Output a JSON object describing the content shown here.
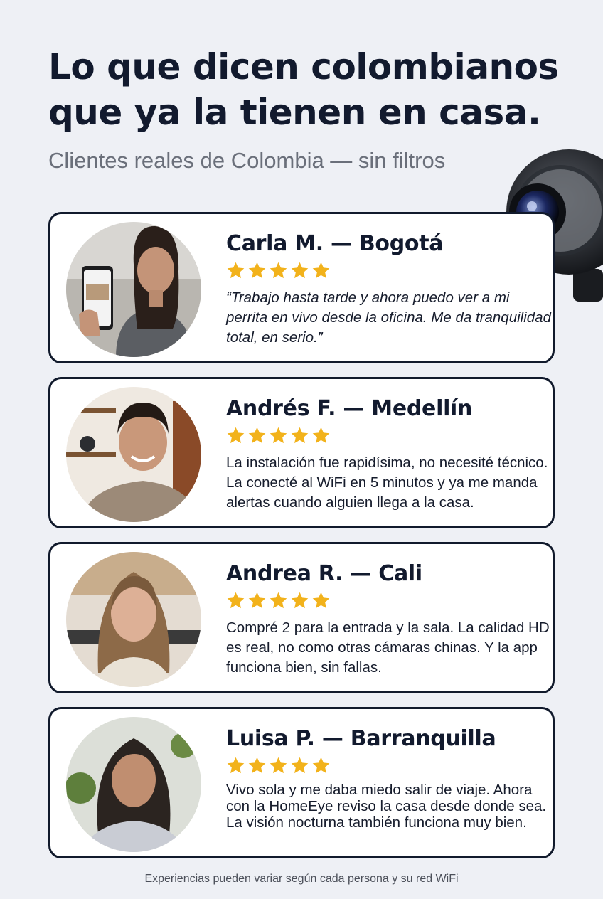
{
  "header": {
    "title": "Lo que dicen colombianos que ya la tienen en casa.",
    "subtitle": "Clientes reales de Colombia — sin filtros"
  },
  "product": {
    "icon": "security-camera-icon"
  },
  "star_color": "#f2b21b",
  "reviews": [
    {
      "name": "Carla M. — Bogotá",
      "rating": 5,
      "quote": "“Trabajo hasta tarde y ahora puedo ver a mi perrita en vivo desde la oficina. Me da tranquilidad total, en serio.”"
    },
    {
      "name": "Andrés F. — Medellín",
      "rating": 5,
      "quote": "La instalación fue rapidísima, no necesité técnico. La conecté al WiFi en 5 minutos y ya me manda alertas cuando alguien llega a la casa."
    },
    {
      "name": "Andrea R. — Cali",
      "rating": 5,
      "quote": "Compré 2 para la entrada y la sala. La calidad HD es real, no como otras cámaras chinas. Y la app funciona bien, sin fallas."
    },
    {
      "name": "Luisa P. — Barranquilla",
      "rating": 5,
      "quote": "Vivo sola y me daba miedo salir de viaje. Ahora con la HomeEye reviso la casa desde donde sea. La visión nocturna también funciona muy bien."
    }
  ],
  "footer": {
    "disclaimer": "Experiencias pueden variar según cada persona y su red WiFi"
  }
}
